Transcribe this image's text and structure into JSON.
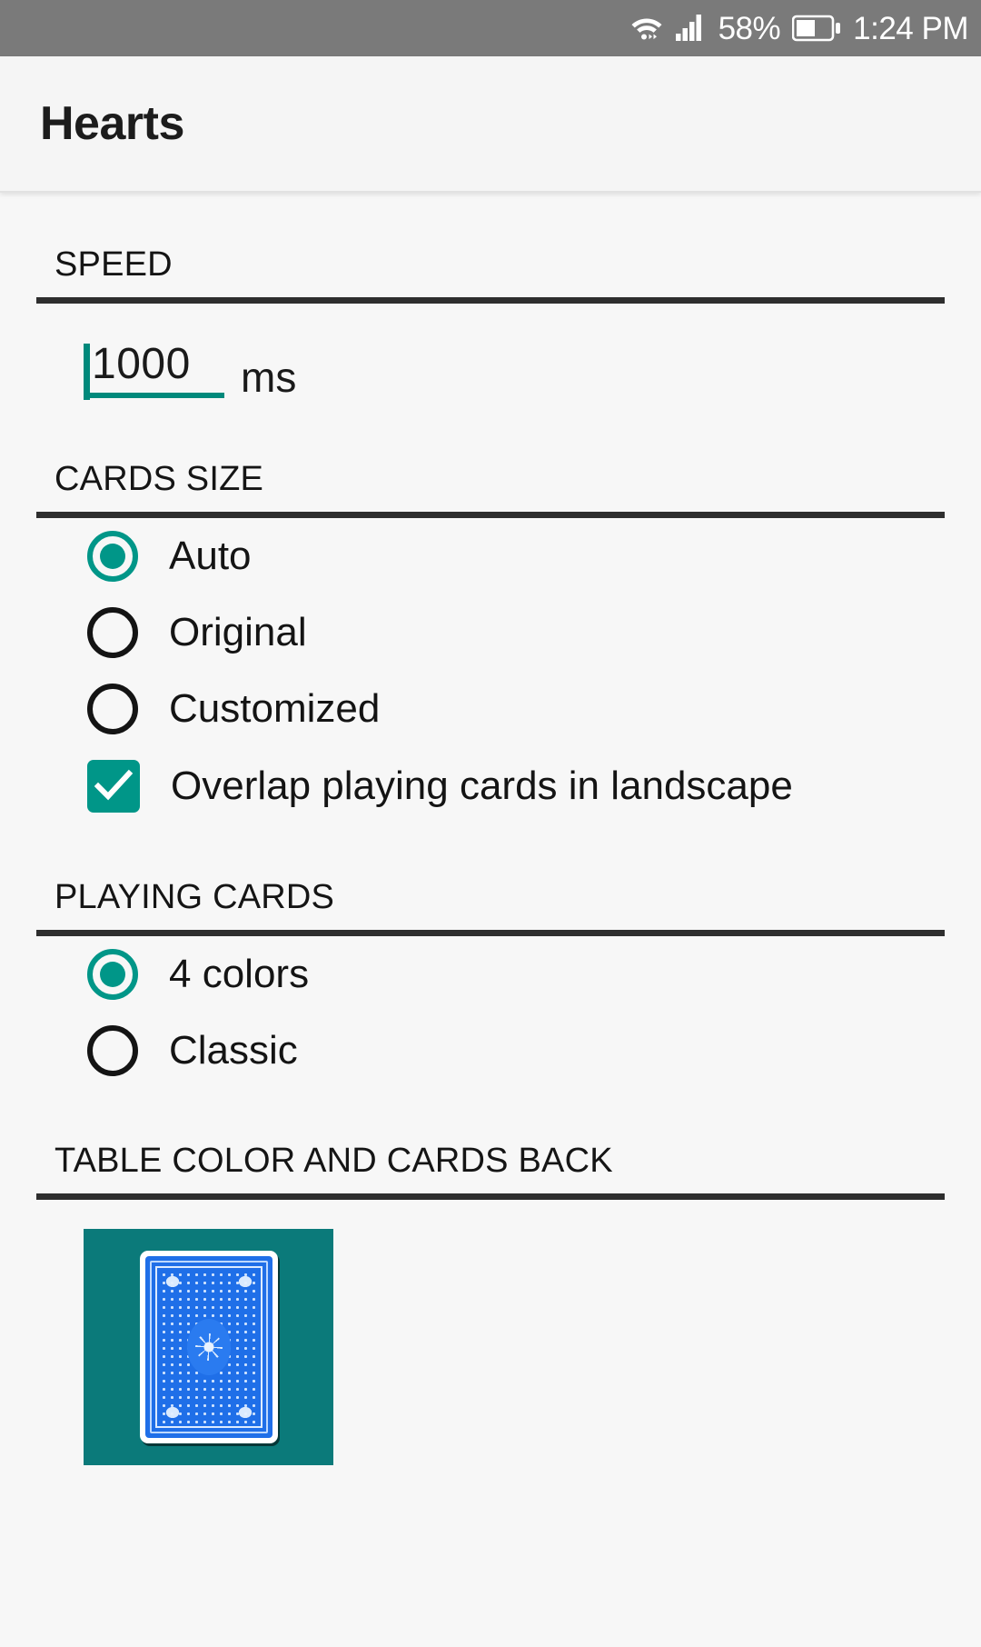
{
  "status_bar": {
    "wifi_icon": "wifi-icon",
    "signal_icon": "cellular-signal-icon",
    "battery_percent": "58%",
    "battery_icon": "battery-icon",
    "battery_level": 58,
    "time": "1:24 PM",
    "background_color": "#7a7a7a"
  },
  "app_bar": {
    "title": "Hearts"
  },
  "accent_color": "#009688",
  "sections": {
    "speed": {
      "header": "SPEED",
      "value": "1000",
      "unit": "ms",
      "placeholder": "1000"
    },
    "cards_size": {
      "header": "CARDS SIZE",
      "options": [
        {
          "label": "Auto",
          "selected": true
        },
        {
          "label": "Original",
          "selected": false
        },
        {
          "label": "Customized",
          "selected": false
        }
      ],
      "checkbox": {
        "label": "Overlap playing cards in landscape",
        "checked": true
      }
    },
    "playing_cards": {
      "header": "PLAYING CARDS",
      "options": [
        {
          "label": "4 colors",
          "selected": true
        },
        {
          "label": "Classic",
          "selected": false
        }
      ]
    },
    "table_color": {
      "header": "TABLE COLOR AND CARDS BACK",
      "swatch_color": "#0b7a7a",
      "card_back_color": "#1f6fe8"
    }
  }
}
